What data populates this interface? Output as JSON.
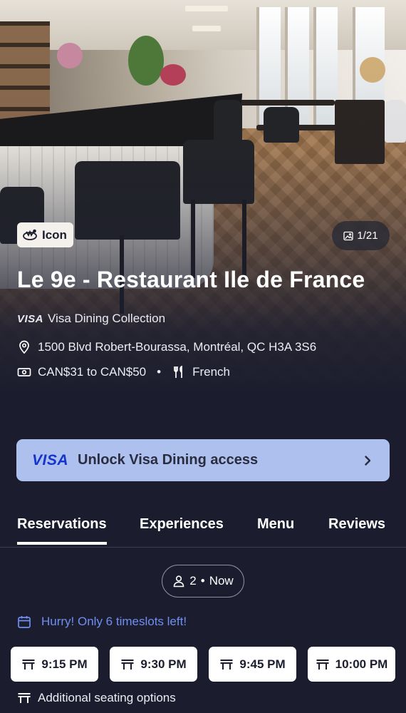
{
  "hero": {
    "badge_label": "Icon",
    "photo_counter": "1/21"
  },
  "restaurant": {
    "name": "Le 9e - Restaurant Ile de France",
    "collection_brand": "VISA",
    "collection_name": "Visa Dining Collection",
    "address": "1500 Blvd Robert-Bourassa, Montréal, QC H3A 3S6",
    "price_range": "CAN$31 to CAN$50",
    "separator": "•",
    "cuisine": "French"
  },
  "visa_banner": {
    "logo": "VISA",
    "label": "Unlock Visa Dining access"
  },
  "tabs": [
    {
      "label": "Reservations",
      "active": true
    },
    {
      "label": "Experiences",
      "active": false
    },
    {
      "label": "Menu",
      "active": false
    },
    {
      "label": "Reviews",
      "active": false
    }
  ],
  "reservation": {
    "party_size": "2",
    "party_separator": "•",
    "party_time": "Now",
    "hurry_message": "Hurry! Only 6 timeslots left!",
    "timeslots": [
      "9:15 PM",
      "9:30 PM",
      "9:45 PM",
      "10:00 PM"
    ],
    "additional_seating": "Additional seating options"
  },
  "icons": {
    "badge": "icon-crown-icon",
    "photos": "image-icon",
    "location": "map-pin-icon",
    "price": "banknote-icon",
    "cuisine": "utensils-icon",
    "chevron": "chevron-right-icon",
    "party": "person-icon",
    "calendar": "calendar-icon",
    "table": "table-icon"
  },
  "colors": {
    "background": "#1b1d2e",
    "visa_banner_bg": "#aec0ee",
    "visa_blue": "#1434cb",
    "hurry_text": "#6f8ff0"
  }
}
